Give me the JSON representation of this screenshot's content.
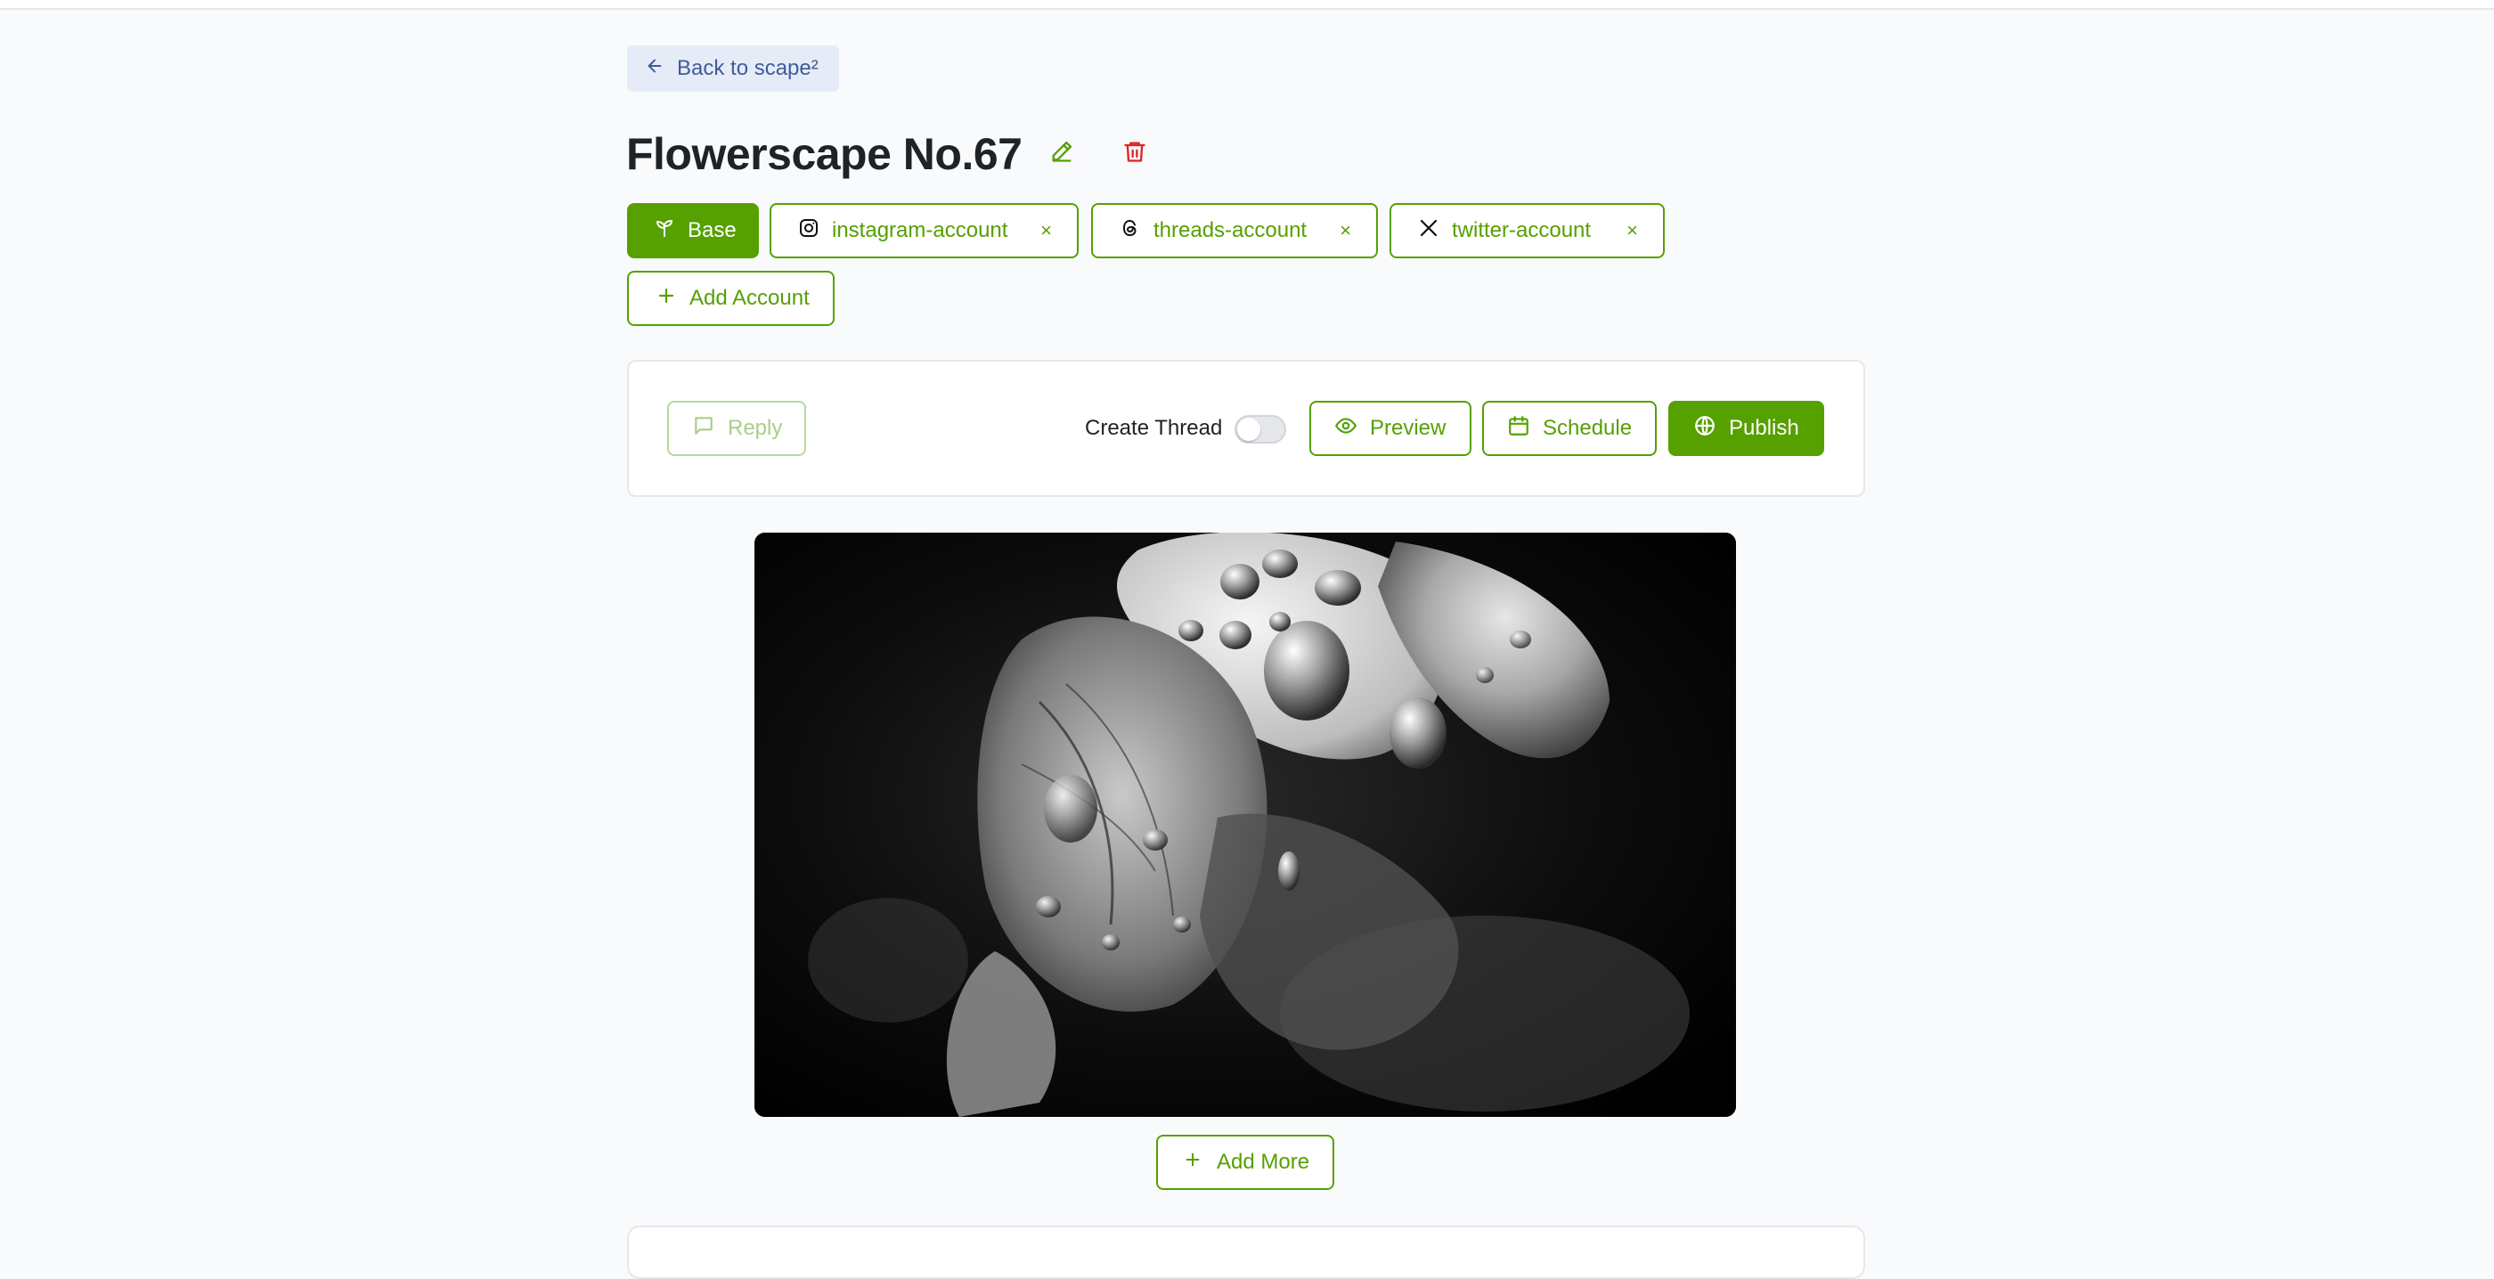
{
  "header": {
    "back_label": "Back to scape²"
  },
  "scape": {
    "title": "Flowerscape No.67"
  },
  "accounts": {
    "base_label": "Base",
    "items": [
      {
        "label": "instagram-account",
        "icon": "instagram-icon"
      },
      {
        "label": "threads-account",
        "icon": "threads-icon"
      },
      {
        "label": "twitter-account",
        "icon": "x-twitter-icon"
      }
    ],
    "remove_glyph": "×",
    "add_label": "Add Account"
  },
  "toolbar": {
    "reply_label": "Reply",
    "create_thread_label": "Create Thread",
    "create_thread_enabled": false,
    "preview_label": "Preview",
    "schedule_label": "Schedule",
    "publish_label": "Publish"
  },
  "media": {
    "add_more_label": "Add More"
  },
  "colors": {
    "accent": "#56a000",
    "danger": "#e02424",
    "back_bg": "#e6ecf7",
    "back_text": "#3f5b9a"
  }
}
